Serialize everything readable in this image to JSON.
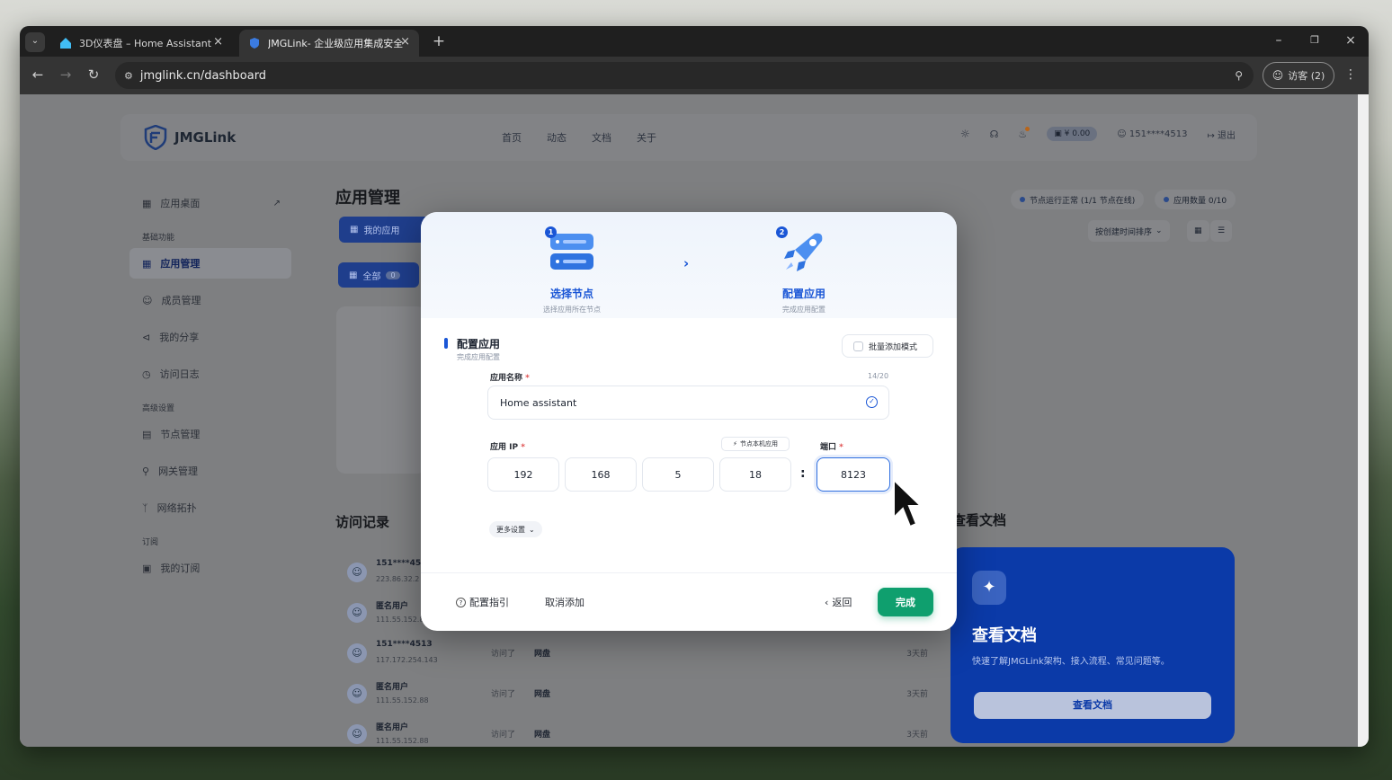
{
  "browser": {
    "tabs": [
      {
        "title": "3D仪表盘 – Home Assistant"
      },
      {
        "title": "JMGLink- 企业级应用集成安全"
      }
    ],
    "url": "jmglink.cn/dashboard",
    "guest_label": "访客 (2)"
  },
  "header": {
    "brand": "JMGLink",
    "nav": [
      "首页",
      "动态",
      "文档",
      "关于"
    ],
    "balance": "¥ 0.00",
    "user": "151****4513",
    "logout": "退出"
  },
  "sidebar": {
    "top_item": "应用桌面",
    "group1": "基础功能",
    "group1_items": [
      "应用管理",
      "成员管理",
      "我的分享",
      "访问日志"
    ],
    "group2": "高级设置",
    "group2_items": [
      "节点管理",
      "网关管理",
      "网络拓扑"
    ],
    "group3": "订阅",
    "group3_items": [
      "我的订阅"
    ]
  },
  "main": {
    "title": "应用管理",
    "my_apps_tab": "我的应用",
    "filter_all": "全部",
    "filter_all_count": "0",
    "node_status": "节点运行正常 (1/1 节点在线)",
    "app_count": "应用数量 0/10",
    "sort_label": "按创建时间排序",
    "visit_title": "访问记录",
    "docs_title": "查看文档",
    "visits": [
      {
        "user": "151****4513",
        "ip": "223.86.32.2",
        "action": "",
        "app": "",
        "time": ""
      },
      {
        "user": "匿名用户",
        "ip": "111.55.152.8",
        "action": "",
        "app": "",
        "time": ""
      },
      {
        "user": "151****4513",
        "ip": "117.172.254.143",
        "action": "访问了",
        "app": "网盘",
        "time": "3天前"
      },
      {
        "user": "匿名用户",
        "ip": "111.55.152.88",
        "action": "访问了",
        "app": "网盘",
        "time": "3天前"
      },
      {
        "user": "匿名用户",
        "ip": "111.55.152.88",
        "action": "访问了",
        "app": "网盘",
        "time": "3天前"
      }
    ],
    "doc_card": {
      "title": "查看文档",
      "desc": "快速了解JMGLink架构、接入流程、常见问题等。",
      "button": "查看文档"
    }
  },
  "modal": {
    "step1": {
      "num": "1",
      "title": "选择节点",
      "sub": "选择应用所在节点"
    },
    "step2": {
      "num": "2",
      "title": "配置应用",
      "sub": "完成应用配置"
    },
    "section_title": "配置应用",
    "section_sub": "完成应用配置",
    "batch_mode": "批量添加模式",
    "name_label": "应用名称",
    "name_counter": "14/20",
    "name_value": "Home assistant",
    "ip_label": "应用 IP",
    "local_app_btn": "节点本机应用",
    "port_label": "端口",
    "ip_octets": [
      "192",
      "168",
      "5",
      "18"
    ],
    "port_value": "8123",
    "more_settings": "更多设置",
    "guide": "配置指引",
    "cancel": "取消添加",
    "back": "返回",
    "done": "完成"
  }
}
